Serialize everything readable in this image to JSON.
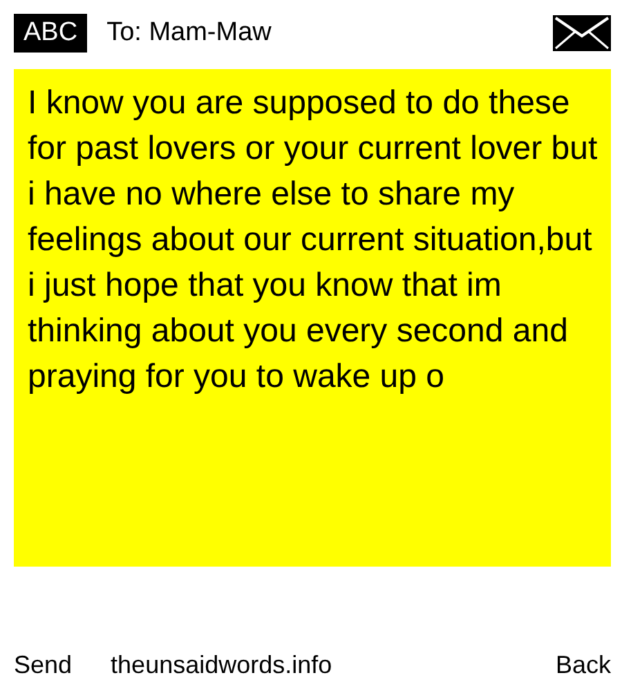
{
  "header": {
    "badge": "ABC",
    "recipient": "To: Mam-Maw"
  },
  "message": {
    "text": "I know you are supposed to do these for past lovers or your current lover but i have no where else to share my feelings about our current situation,but i just hope that you know that im thinking about you every second and praying for you to wake up o"
  },
  "footer": {
    "send": "Send",
    "site": "theunsaidwords.info",
    "back": "Back"
  }
}
